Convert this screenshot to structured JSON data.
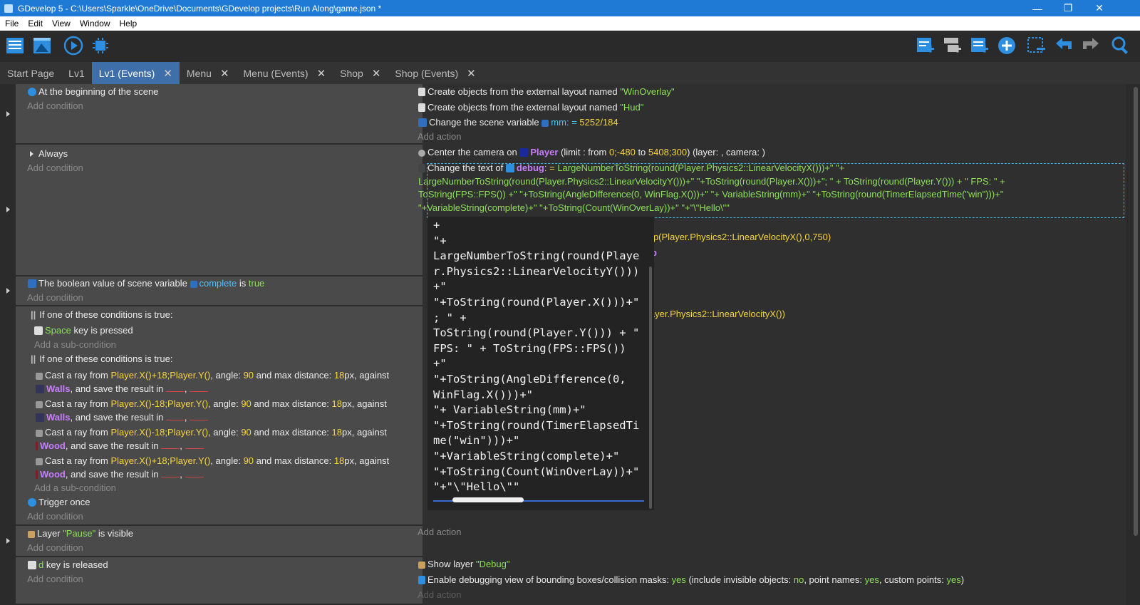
{
  "window": {
    "title": "GDevelop 5 - C:\\Users\\Sparkle\\OneDrive\\Documents\\GDevelop projects\\Run Along\\game.json *",
    "minimize": "—",
    "maximize": "❐",
    "close": "✕"
  },
  "menu": [
    "File",
    "Edit",
    "View",
    "Window",
    "Help"
  ],
  "toolbar": {
    "left_icons": [
      "project-manager-icon",
      "scene-editor-icon",
      "preview-play-icon",
      "debug-chip-icon"
    ],
    "right_icons": [
      "add-event-icon",
      "add-subevent-icon",
      "add-comment-icon",
      "add-circle-icon",
      "delete-event-icon",
      "undo-icon",
      "redo-icon",
      "search-icon"
    ]
  },
  "tabs": [
    {
      "label": "Start Page",
      "closable": false,
      "active": false
    },
    {
      "label": "Lv1",
      "closable": false,
      "active": false
    },
    {
      "label": "Lv1 (Events)",
      "closable": true,
      "active": true
    },
    {
      "label": "Menu",
      "closable": true,
      "active": false
    },
    {
      "label": "Menu (Events)",
      "closable": true,
      "active": false
    },
    {
      "label": "Shop",
      "closable": true,
      "active": false
    },
    {
      "label": "Shop (Events)",
      "closable": true,
      "active": false
    }
  ],
  "close_glyph": "✕",
  "labels": {
    "add_condition": "Add condition",
    "add_action": "Add action",
    "add_subcondition": "Add a sub-condition"
  },
  "events": {
    "e1": {
      "condition": "At the beginning of the scene"
    },
    "e2": {
      "condition": "Always"
    },
    "e3": {
      "pre": "The boolean value of scene variable",
      "var": "complete",
      "mid": "is",
      "val": "true"
    },
    "e4": {
      "or1": "If one of these conditions is true:",
      "key1": "Space",
      "key1_rest": "key is pressed",
      "or2": "If one of these conditions is true:",
      "rays": [
        {
          "from": "Player.X()+18;Player.Y()",
          "angle": "90",
          "dist": "18",
          "target": "Walls"
        },
        {
          "from": "Player.X()-18;Player.Y()",
          "angle": "90",
          "dist": "18",
          "target": "Walls"
        },
        {
          "from": "Player.X()-18;Player.Y()",
          "angle": "90",
          "dist": "18",
          "target": "Wood"
        },
        {
          "from": "Player.X()+18;Player.Y()",
          "angle": "90",
          "dist": "18",
          "target": "Wood"
        }
      ],
      "ray_t1": "Cast a ray from",
      "ray_t2": ", angle:",
      "ray_t3": "and max distance:",
      "ray_t4": "px, against",
      "ray_t5": ", and save the result in",
      "ray_comma": ",",
      "trigger": "Trigger once"
    },
    "e5": {
      "pre": "Layer",
      "layer": "\"Pause\"",
      "rest": "is visible"
    },
    "e6": {
      "key": "d",
      "rest": "key is released"
    }
  },
  "actions": {
    "a1": {
      "pre": "Create objects from the external layout named",
      "val": "\"WinOverlay\""
    },
    "a2": {
      "pre": "Create objects from the external layout named",
      "val": "\"Hud\""
    },
    "a3": {
      "pre": "Change the scene variable",
      "var": "mm",
      "op": ": =",
      "val": "5252/184"
    },
    "a4": {
      "pre": "Center the camera on",
      "obj": "Player",
      "t1": "(limit : from",
      "v1": "0;-480",
      "t2": "to",
      "v2": "5408;300",
      "t3": ") (layer: , camera: )"
    },
    "a5": {
      "pre": "Change the text of",
      "obj": "debug",
      "op": ": =",
      "l1": "LargeNumberToString(round(Player.Physics2::LinearVelocityX()))+\" \"+",
      "l2": "LargeNumberToString(round(Player.Physics2::LinearVelocityY()))+\" \"+ToString(round(Player.X()))+\"; \" + ToString(round(Player.Y())) + \" FPS: \" +",
      "l3": "ToString(FPS::FPS()) +\" \"+ToString(AngleDifference(0, WinFlag.X()))+\" \"+ VariableString(mm)+\" \"+ToString(round(TimerElapsedTime(\"win\")))+\"",
      "l4": "\"+VariableString(complete)+\" \"+ToString(Count(WinOverLay))+\" \"+\"\\\"Hello\\\"\""
    },
    "partial1": "lamp(Player.Physics2::LinearVelocityX(),0,750)",
    "partial2": "Map",
    "partial3": "(Player.Physics2::LinearVelocityX())",
    "a6": {
      "pre": "Show layer",
      "val": "\"Debug\""
    },
    "a7": {
      "pre": "Enable debugging view of bounding boxes/collision masks:",
      "v1": "yes",
      "t1": "(include invisible objects:",
      "v2": "no",
      "t2": ", point names:",
      "v3": "yes",
      "t3": ", custom points:",
      "v4": "yes",
      "t4": ")"
    }
  },
  "tooltip": {
    "text": "+\n\"+\nLargeNumberToString(round(Playe\nr.Physics2::LinearVelocityY()))\n+\"\n\"+ToString(round(Player.X()))+\"\n; \" +\nToString(round(Player.Y())) + \"\nFPS: \" + ToString(FPS::FPS())\n+\"\n\"+ToString(AngleDifference(0,\nWinFlag.X()))+\"\n\"+ VariableString(mm)+\"\n\"+ToString(round(TimerElapsedTi\nme(\"win\")))+\"\n\"+VariableString(complete)+\"\n\"+ToString(Count(WinOverLay))+\"\n\"+\"\\\"Hello\\\"\""
  },
  "colors": {
    "accent": "#1f7ad6",
    "tab_active": "#3f6fa8",
    "green": "#8ee05a",
    "yellow": "#f4d440",
    "purple": "#c77dff",
    "cyan": "#4fc3f7"
  }
}
